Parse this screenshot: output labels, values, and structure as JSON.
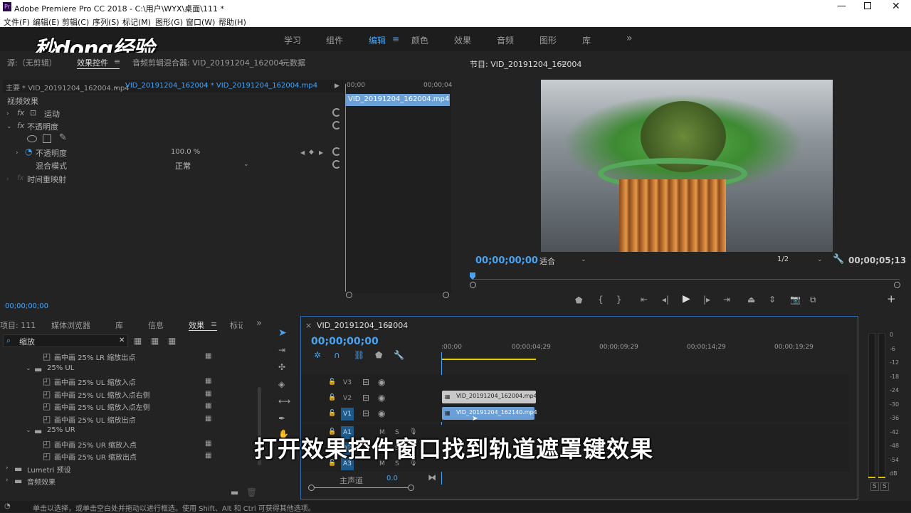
{
  "window": {
    "title": "Adobe Premiere Pro CC 2018 - C:\\用户\\WYX\\桌面\\111 *"
  },
  "menu": [
    "文件(F)",
    "编辑(E)",
    "剪辑(C)",
    "序列(S)",
    "标记(M)",
    "图形(G)",
    "窗口(W)",
    "帮助(H)"
  ],
  "watermark": "秒dong经验",
  "workspaces": [
    "学习",
    "组件",
    "编辑",
    "颜色",
    "效果",
    "音频",
    "图形",
    "库"
  ],
  "source_tabs": {
    "source": "源:（无剪辑）",
    "effect_controls": "效果控件",
    "audio_mixer": "音频剪辑混合器: VID_20191204_162004",
    "metadata": "元数据"
  },
  "effect_controls": {
    "master": "主要 * VID_20191204_162004.mp4",
    "sequence_clip": "VID_20191204_162004 * VID_20191204_162004.mp4",
    "ruler_start": "00;00",
    "ruler_end": "00;00;04",
    "clip_label": "VID_20191204_162004.mp4",
    "video_effects": "视频效果",
    "motion": "运动",
    "opacity": "不透明度",
    "opacity_param": "不透明度",
    "opacity_value": "100.0 %",
    "blend_mode_label": "混合模式",
    "blend_mode_value": "正常",
    "time_remap": "时间重映射",
    "timecode": "00;00;00;00"
  },
  "program": {
    "title": "节目: VID_20191204_162004",
    "timecode_current": "00;00;00;00",
    "fit": "适合",
    "resolution": "1/2",
    "timecode_duration": "00;00;05;13"
  },
  "project": {
    "tabs": [
      "项目: 111",
      "媒体浏览器",
      "库",
      "信息",
      "效果",
      "标记"
    ],
    "search": "缩放",
    "tree": [
      {
        "label": "画中画 25% LR 缩放出点",
        "level": 2,
        "kind": "preset"
      },
      {
        "label": "25% UL",
        "level": 1,
        "kind": "folder"
      },
      {
        "label": "画中画 25% UL 缩放入点",
        "level": 2,
        "kind": "preset"
      },
      {
        "label": "画中画 25% UL 缩放入点右侧",
        "level": 2,
        "kind": "preset"
      },
      {
        "label": "画中画 25% UL 缩放入点左侧",
        "level": 2,
        "kind": "preset"
      },
      {
        "label": "画中画 25% UL 缩放出点",
        "level": 2,
        "kind": "preset"
      },
      {
        "label": "25% UR",
        "level": 1,
        "kind": "folder"
      },
      {
        "label": "画中画 25% UR 缩放入点",
        "level": 2,
        "kind": "preset"
      },
      {
        "label": "画中画 25% UR 缩放出点",
        "level": 2,
        "kind": "preset"
      },
      {
        "label": "Lumetri 预设",
        "level": 0,
        "kind": "folder"
      },
      {
        "label": "音频效果",
        "level": 0,
        "kind": "folder"
      }
    ]
  },
  "timeline": {
    "sequence": "VID_20191204_162004",
    "timecode": "00;00;00;00",
    "ruler": [
      ":00;00",
      "00;00;04;29",
      "00;00;09;29",
      "00;00;14;29",
      "00;00;19;29"
    ],
    "tracks": [
      "V3",
      "V2",
      "V1",
      "A1",
      "A2",
      "A3"
    ],
    "clip_v2": "VID_20191204_162004.mp4",
    "clip_v1": "VID_20191204_162140.mp4",
    "master_label": "主声道",
    "master_value": "0.0"
  },
  "meter": {
    "scale": [
      "0",
      "-6",
      "-12",
      "-18",
      "-24",
      "-30",
      "-36",
      "-42",
      "-48",
      "-54",
      "dB"
    ]
  },
  "status": "单击以选择，或单击空白处并拖动以进行框选。使用 Shift、Alt 和 Ctrl 可获得其他选项。",
  "subtitle": "打开效果控件窗口找到轨道遮罩键效果"
}
